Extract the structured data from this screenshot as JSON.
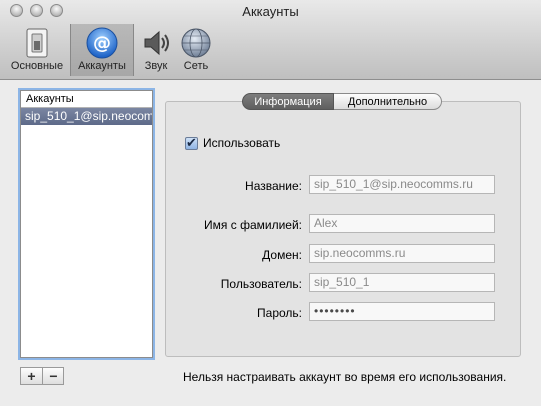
{
  "window": {
    "title": "Аккаунты"
  },
  "toolbar": {
    "items": [
      {
        "label": "Основные",
        "icon": "switch-icon",
        "selected": false
      },
      {
        "label": "Аккаунты",
        "icon": "at-sign-icon",
        "selected": true
      },
      {
        "label": "Звук",
        "icon": "speaker-icon",
        "selected": false
      },
      {
        "label": "Сеть",
        "icon": "globe-icon",
        "selected": false
      }
    ]
  },
  "accounts": {
    "header": "Аккаунты",
    "items": [
      {
        "label": "sip_510_1@sip.neocomms.ru",
        "selected": true
      }
    ],
    "add_label": "+",
    "remove_label": "−"
  },
  "tabs": [
    {
      "label": "Информация",
      "selected": true
    },
    {
      "label": "Дополнительно",
      "selected": false
    }
  ],
  "form": {
    "enabled_label": "Использовать",
    "enabled_checked": true,
    "fields": [
      {
        "label": "Название:",
        "value": "sip_510_1@sip.neocomms.ru"
      },
      {
        "label": "Имя с фамилией:",
        "value": "Alex"
      },
      {
        "label": "Домен:",
        "value": "sip.neocomms.ru"
      },
      {
        "label": "Пользователь:",
        "value": "sip_510_1"
      },
      {
        "label": "Пароль:",
        "value": "••••••••"
      }
    ]
  },
  "footer_note": "Нельзя настраивать аккаунт во время его использования.",
  "colors": {
    "selection": "#5d6a89",
    "focus_ring": "#8cb5e6",
    "accent_blue": "#2f7fe0"
  }
}
